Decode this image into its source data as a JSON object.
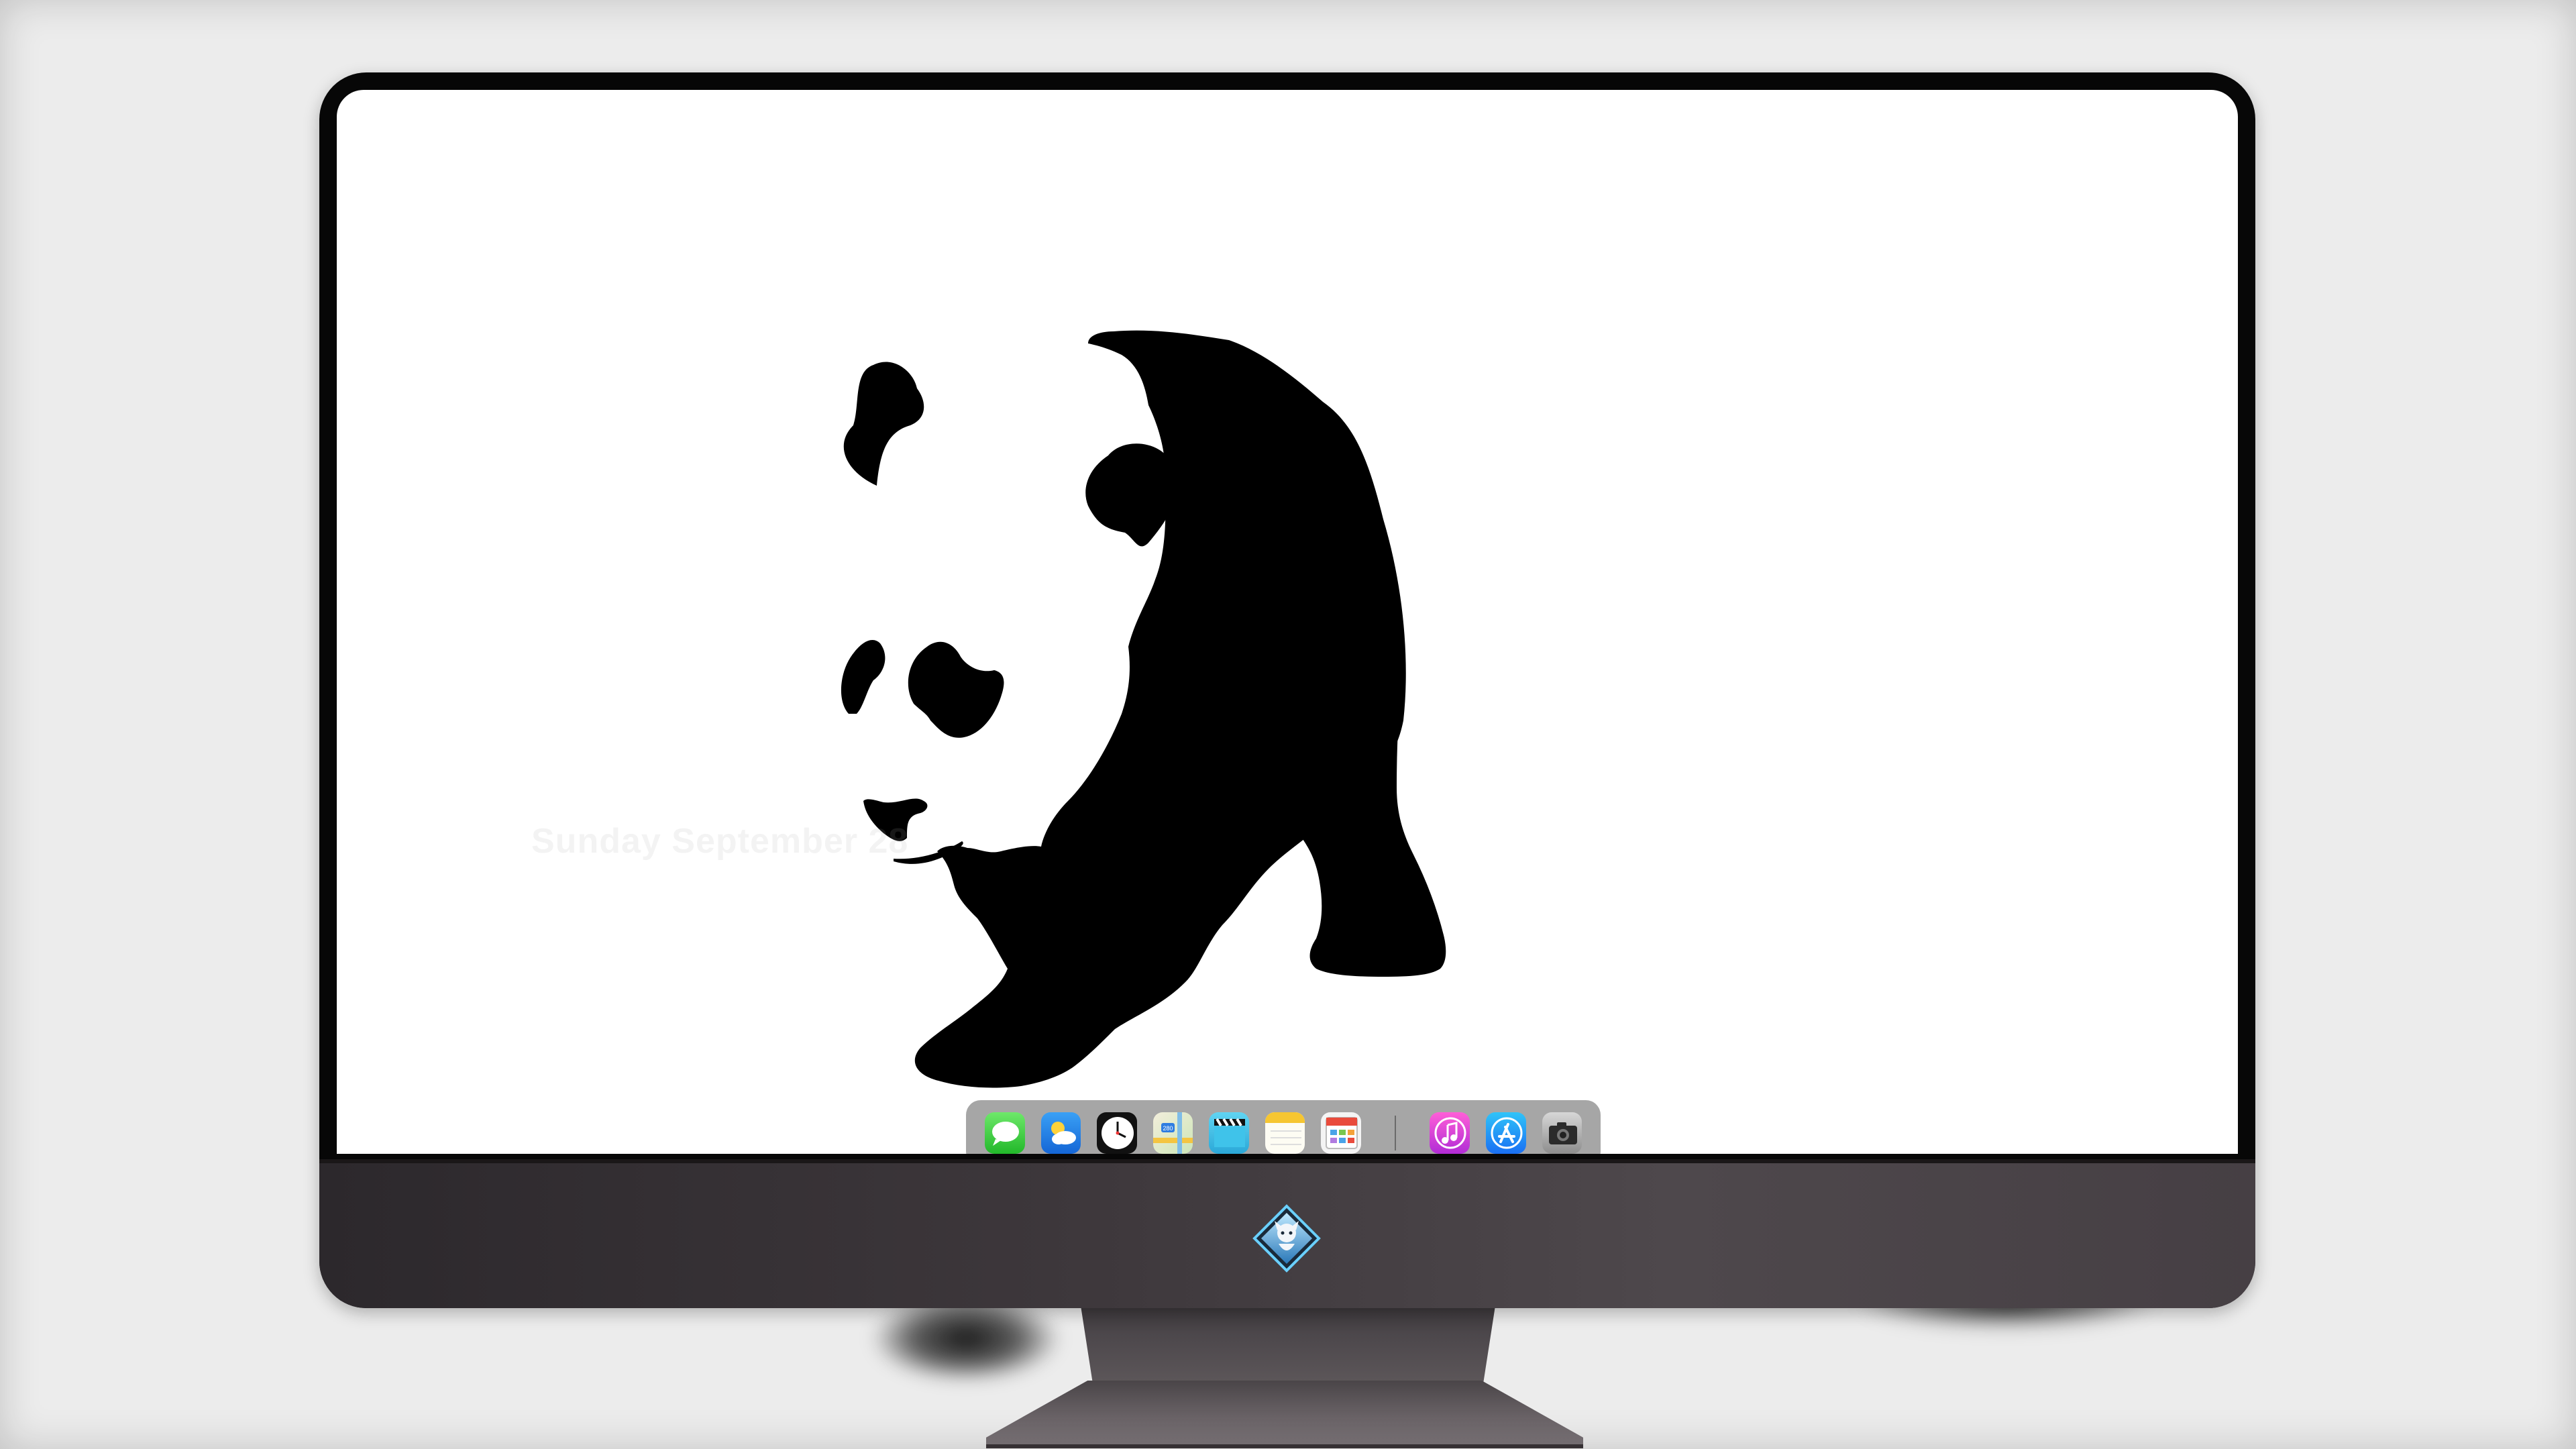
{
  "desktop": {
    "date_text": "Sunday  September   28",
    "sub_text": "",
    "wallpaper": "panda-silhouette"
  },
  "dock": {
    "apps": [
      {
        "name": "Messages",
        "icon": "messages-icon"
      },
      {
        "name": "Weather",
        "icon": "weather-icon"
      },
      {
        "name": "Clock",
        "icon": "clock-icon"
      },
      {
        "name": "Maps",
        "icon": "maps-icon"
      },
      {
        "name": "Videos",
        "icon": "videos-icon"
      },
      {
        "name": "Notes",
        "icon": "notes-icon"
      },
      {
        "name": "Calendar",
        "icon": "calendar-icon"
      },
      {
        "name": "Music",
        "icon": "music-icon"
      },
      {
        "name": "App Store",
        "icon": "app-store-icon"
      },
      {
        "name": "Camera",
        "icon": "camera-icon"
      }
    ]
  },
  "colors": {
    "page_background": "#ececec",
    "bezel": "#070707",
    "chin": "#3e383c",
    "screen": "#ffffff",
    "dock": "#a6a6a6",
    "silhouette": "#000000"
  }
}
